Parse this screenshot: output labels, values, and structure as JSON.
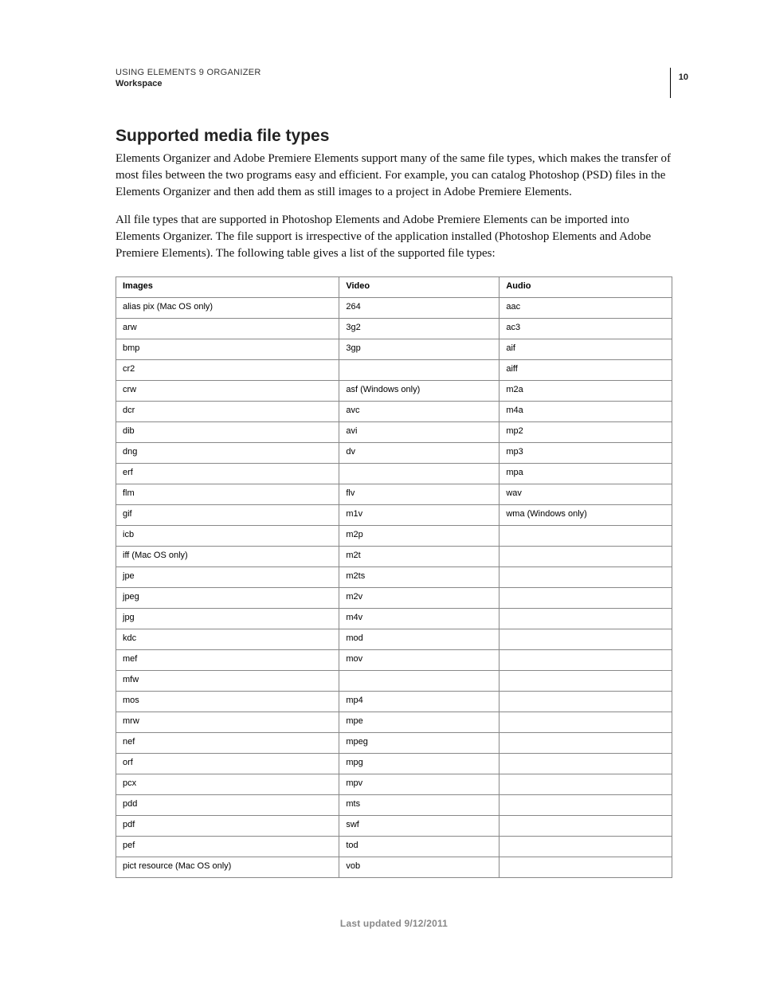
{
  "header": {
    "doc_title": "USING ELEMENTS 9 ORGANIZER",
    "section": "Workspace",
    "page_number": "10"
  },
  "heading": "Supported media file types",
  "para1": "Elements Organizer and Adobe Premiere Elements support many of the same file types, which makes the transfer of most files between the two programs easy and efficient. For example, you can catalog Photoshop (PSD) files in the Elements Organizer and then add them as still images to a project in Adobe Premiere Elements.",
  "para2": "All file types that are supported in Photoshop Elements and Adobe Premiere Elements can be imported into Elements Organizer. The file support is irrespective of the application installed (Photoshop Elements and Adobe Premiere Elements). The following table gives a list of the supported file types:",
  "table": {
    "headers": [
      "Images",
      "Video",
      "Audio"
    ],
    "rows": [
      [
        "alias pix (Mac OS only)",
        "264",
        "aac"
      ],
      [
        "arw",
        "3g2",
        "ac3"
      ],
      [
        "bmp",
        "3gp",
        "aif"
      ],
      [
        "cr2",
        "",
        "aiff"
      ],
      [
        "crw",
        "asf (Windows only)",
        "m2a"
      ],
      [
        "dcr",
        "avc",
        "m4a"
      ],
      [
        "dib",
        "avi",
        "mp2"
      ],
      [
        "dng",
        "dv",
        "mp3"
      ],
      [
        "erf",
        "",
        "mpa"
      ],
      [
        "flm",
        "flv",
        "wav"
      ],
      [
        "gif",
        "m1v",
        "wma (Windows only)"
      ],
      [
        "icb",
        "m2p",
        ""
      ],
      [
        "iff (Mac OS only)",
        "m2t",
        ""
      ],
      [
        "jpe",
        "m2ts",
        ""
      ],
      [
        "jpeg",
        "m2v",
        ""
      ],
      [
        "jpg",
        "m4v",
        ""
      ],
      [
        "kdc",
        "mod",
        ""
      ],
      [
        "mef",
        "mov",
        ""
      ],
      [
        "mfw",
        "",
        ""
      ],
      [
        "mos",
        "mp4",
        ""
      ],
      [
        "mrw",
        "mpe",
        ""
      ],
      [
        "nef",
        "mpeg",
        ""
      ],
      [
        "orf",
        "mpg",
        ""
      ],
      [
        "pcx",
        "mpv",
        ""
      ],
      [
        "pdd",
        "mts",
        ""
      ],
      [
        "pdf",
        "swf",
        ""
      ],
      [
        "pef",
        "tod",
        ""
      ],
      [
        "pict resource (Mac OS only)",
        "vob",
        ""
      ]
    ]
  },
  "footer": "Last updated 9/12/2011"
}
